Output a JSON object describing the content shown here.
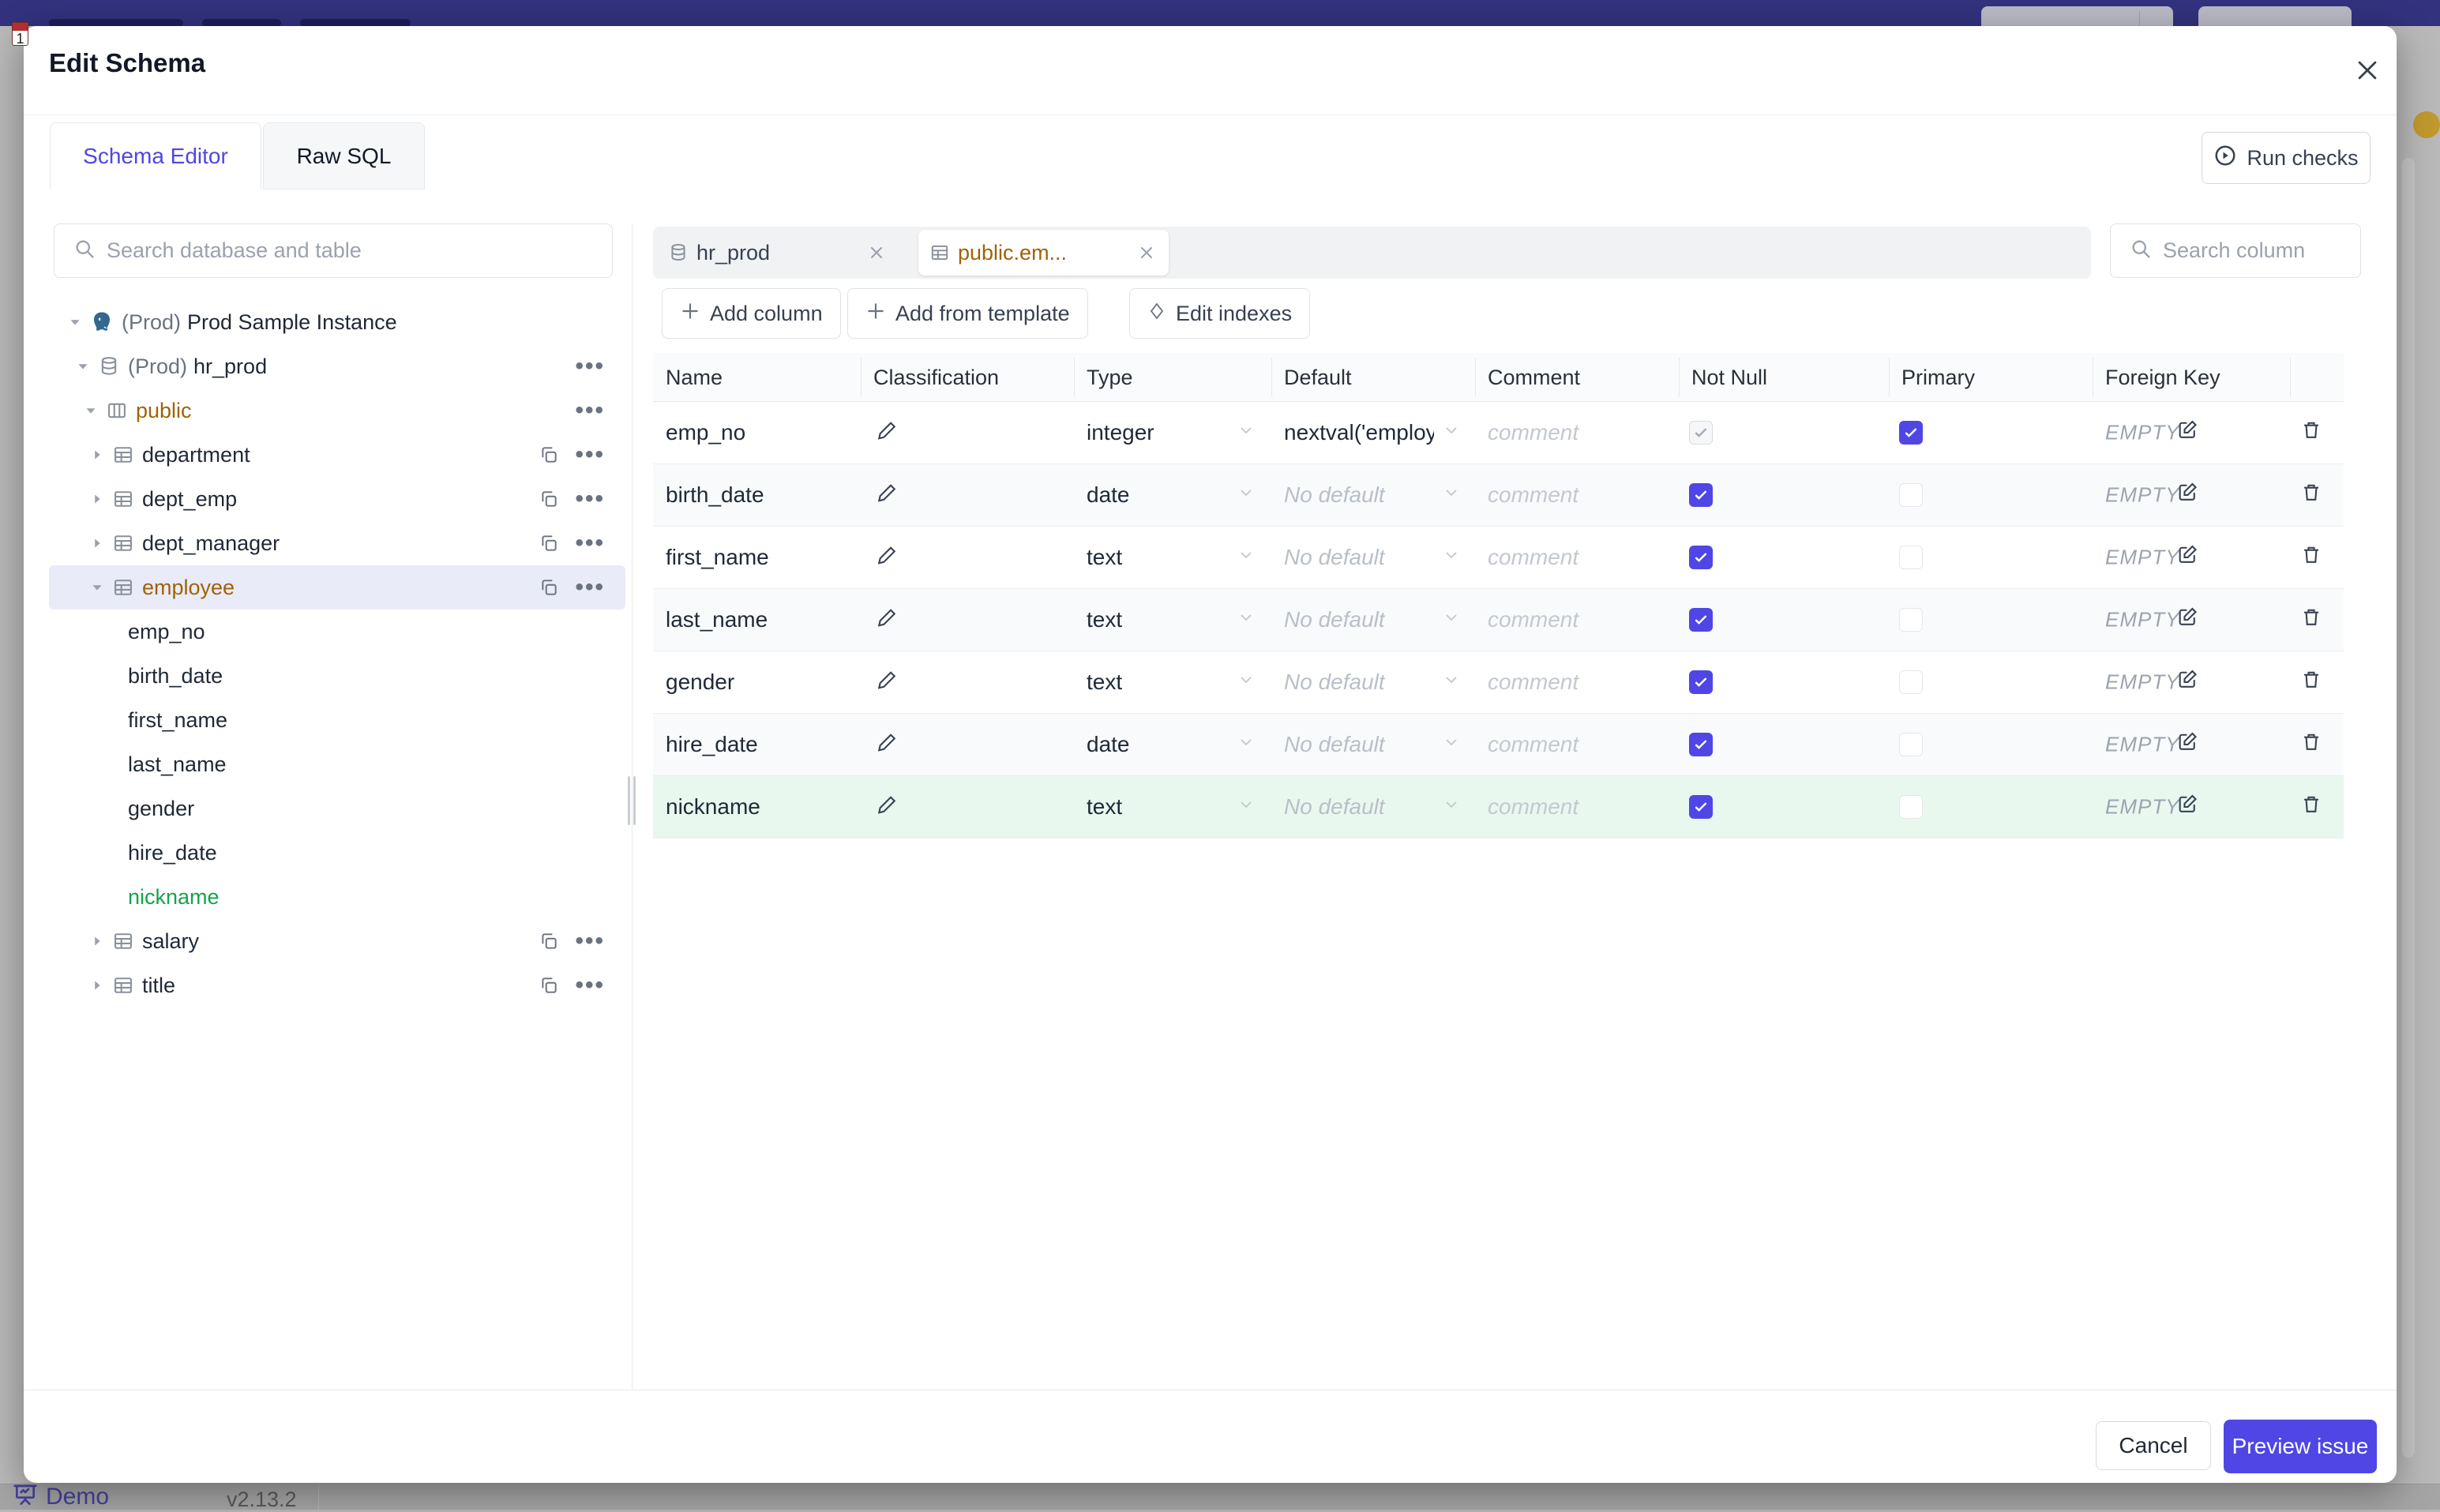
{
  "backdrop": {
    "favicon_text": "1",
    "demo_label": "Demo",
    "version": "v2.13.2"
  },
  "modal": {
    "title": "Edit Schema",
    "tabs": {
      "schema_editor": "Schema Editor",
      "raw_sql": "Raw SQL"
    },
    "run_checks_label": "Run checks",
    "sidebar": {
      "search_placeholder": "Search database and table",
      "tree": [
        {
          "prefix": "(Prod)",
          "label": "Prod Sample Instance"
        },
        {
          "prefix": "(Prod)",
          "label": "hr_prod"
        },
        {
          "label": "public"
        },
        {
          "label": "department"
        },
        {
          "label": "dept_emp"
        },
        {
          "label": "dept_manager"
        },
        {
          "label": "employee"
        },
        {
          "label": "emp_no"
        },
        {
          "label": "birth_date"
        },
        {
          "label": "first_name"
        },
        {
          "label": "last_name"
        },
        {
          "label": "gender"
        },
        {
          "label": "hire_date"
        },
        {
          "label": "nickname"
        },
        {
          "label": "salary"
        },
        {
          "label": "title"
        }
      ]
    },
    "editor": {
      "chips": [
        {
          "label": "hr_prod"
        },
        {
          "label": "public.em..."
        }
      ],
      "column_search_placeholder": "Search column",
      "actions": {
        "add_column": "Add column",
        "add_from_template": "Add from template",
        "edit_indexes": "Edit indexes"
      },
      "table": {
        "headers": {
          "name": "Name",
          "classification": "Classification",
          "type": "Type",
          "default": "Default",
          "comment": "Comment",
          "not_null": "Not Null",
          "primary": "Primary",
          "foreign_key": "Foreign Key"
        },
        "comment_placeholder": "comment",
        "fk_empty": "EMPTY",
        "rows": [
          {
            "name": "emp_no",
            "type": "integer",
            "default": "nextval('employ",
            "not_null": "checked-disabled",
            "primary": true
          },
          {
            "name": "birth_date",
            "type": "date",
            "default": "No default",
            "not_null": "checked",
            "primary": false
          },
          {
            "name": "first_name",
            "type": "text",
            "default": "No default",
            "not_null": "checked",
            "primary": false
          },
          {
            "name": "last_name",
            "type": "text",
            "default": "No default",
            "not_null": "checked",
            "primary": false
          },
          {
            "name": "gender",
            "type": "text",
            "default": "No default",
            "not_null": "checked",
            "primary": false
          },
          {
            "name": "hire_date",
            "type": "date",
            "default": "No default",
            "not_null": "checked",
            "primary": false
          },
          {
            "name": "nickname",
            "type": "text",
            "default": "No default",
            "not_null": "checked",
            "primary": false,
            "state": "new"
          }
        ]
      }
    },
    "footer": {
      "cancel_label": "Cancel",
      "preview_label": "Preview issue"
    }
  }
}
